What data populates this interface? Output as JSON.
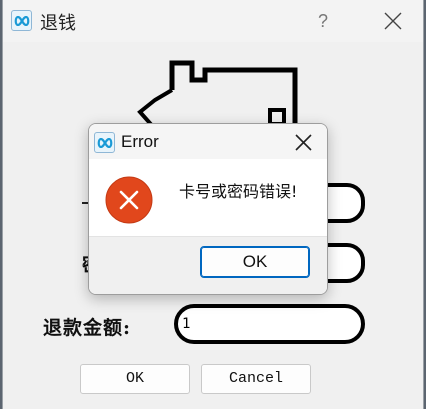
{
  "window": {
    "title": "退钱",
    "help_label": "?",
    "icons": {
      "app": "infinity-app-icon",
      "close": "close-icon"
    }
  },
  "form": {
    "partial_label": "密",
    "amount_label": "退款金额:",
    "amount_value": "1",
    "ok_label": "OK",
    "cancel_label": "Cancel"
  },
  "dialog": {
    "title": "Error",
    "message": "卡号或密码错误!",
    "ok_label": "OK",
    "icons": {
      "app": "infinity-app-icon",
      "status": "error-icon",
      "close": "close-icon"
    }
  },
  "colors": {
    "error_red": "#e1471c",
    "accent_blue": "#0067c0",
    "app_icon_blue": "#1a9ad6"
  }
}
